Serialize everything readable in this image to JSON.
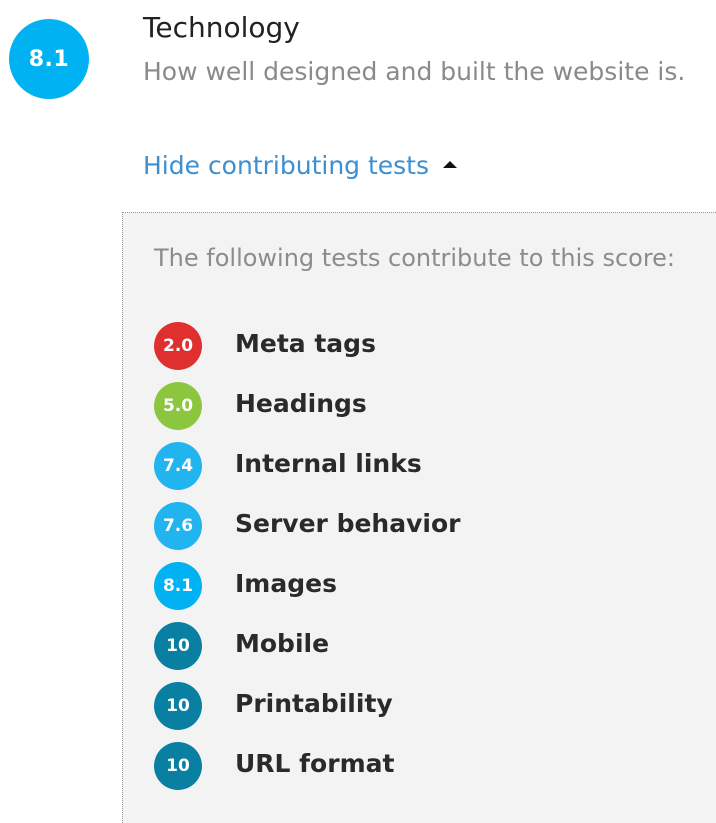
{
  "category": {
    "score": "8.1",
    "score_color": "#00b2f2",
    "title": "Technology",
    "description": "How well designed and built the website is."
  },
  "toggle": {
    "label": "Hide contributing tests",
    "icon": "caret-up-icon"
  },
  "panel": {
    "intro": "The following tests contribute to this score:",
    "tests": [
      {
        "score": "2.0",
        "name": "Meta tags",
        "color": "#e02f2f"
      },
      {
        "score": "5.0",
        "name": "Headings",
        "color": "#8cc63e"
      },
      {
        "score": "7.4",
        "name": "Internal links",
        "color": "#21b4ee"
      },
      {
        "score": "7.6",
        "name": "Server behavior",
        "color": "#21b4ee"
      },
      {
        "score": "8.1",
        "name": "Images",
        "color": "#00b2f2"
      },
      {
        "score": "10",
        "name": "Mobile",
        "color": "#097fa2"
      },
      {
        "score": "10",
        "name": "Printability",
        "color": "#097fa2"
      },
      {
        "score": "10",
        "name": "URL format",
        "color": "#097fa2"
      }
    ]
  }
}
